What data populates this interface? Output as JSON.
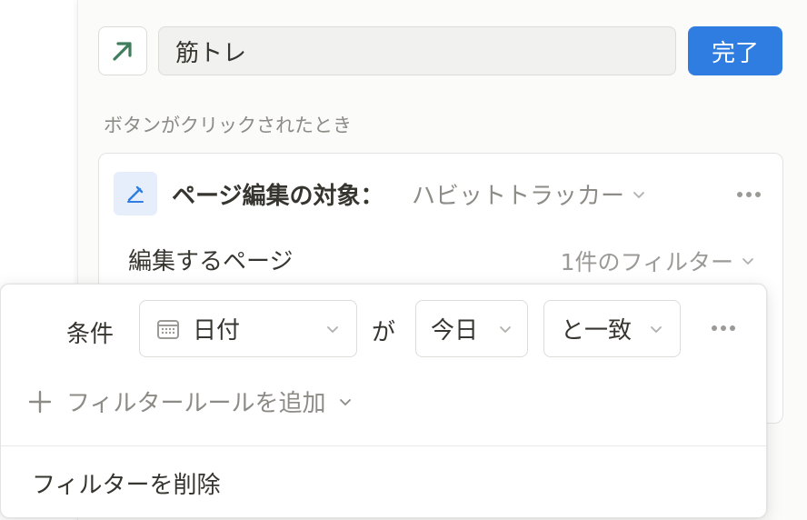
{
  "button_editor": {
    "icon": "arrow-up-right-icon",
    "name_value": "筋トレ",
    "done_label": "完了",
    "trigger_label": "ボタンがクリックされたとき",
    "action": {
      "icon": "pencil-icon",
      "title": "ページ編集の対象：",
      "target": "ハビットトラッカー",
      "edit_label": "編集するページ",
      "filter_count": "1件のフィルター"
    }
  },
  "filter_popover": {
    "condition_label": "条件",
    "property": "日付",
    "particle": "が",
    "value": "今日",
    "operator": "と一致",
    "add_rule_label": "フィルタールールを追加",
    "delete_label": "フィルターを削除"
  },
  "colors": {
    "accent": "#2f7de1",
    "arrow_green": "#3f7d5c",
    "muted_text": "#8d8b86"
  }
}
